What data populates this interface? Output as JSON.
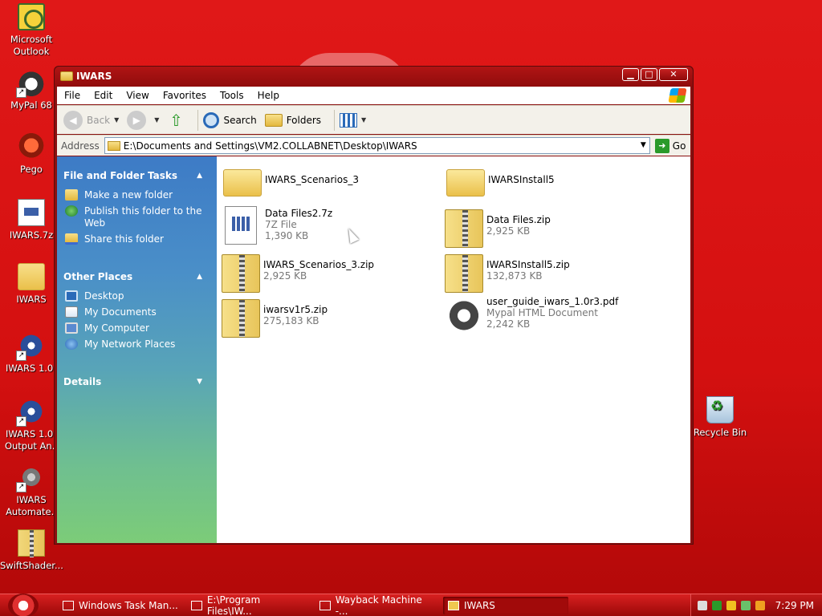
{
  "desktop": {
    "icons": [
      {
        "label": "Microsoft Outlook",
        "icon": "outlook-icon"
      },
      {
        "label": "MyPal 68",
        "icon": "mypal-icon"
      },
      {
        "label": "Pego",
        "icon": "pego-icon"
      },
      {
        "label": "IWARS.7z",
        "icon": "7z-file-icon"
      },
      {
        "label": "IWARS",
        "icon": "folder-icon"
      },
      {
        "label": "IWARS 1.0r",
        "icon": "iwars-icon"
      },
      {
        "label": "IWARS 1.0r Output An..",
        "icon": "iwars-icon"
      },
      {
        "label": "IWARS Automate..",
        "icon": "gear-icon"
      },
      {
        "label": "SwiftShader...",
        "icon": "zip-icon"
      },
      {
        "label": "Recycle Bin",
        "icon": "recycle-bin-icon"
      }
    ]
  },
  "window": {
    "title": "IWARS",
    "buttons": {
      "minimize": "▁",
      "maximize": "□",
      "close": "✕"
    }
  },
  "menu": [
    "File",
    "Edit",
    "View",
    "Favorites",
    "Tools",
    "Help"
  ],
  "toolbar": {
    "back": "Back",
    "search": "Search",
    "folders": "Folders"
  },
  "address": {
    "label": "Address",
    "value": "E:\\Documents and Settings\\VM2.COLLABNET\\Desktop\\IWARS",
    "go": "Go"
  },
  "left_pane": {
    "file_tasks": {
      "title": "File and Folder Tasks",
      "items": [
        "Make a new folder",
        "Publish this folder to the Web",
        "Share this folder"
      ]
    },
    "other_places": {
      "title": "Other Places",
      "items": [
        "Desktop",
        "My Documents",
        "My Computer",
        "My Network Places"
      ]
    },
    "details": {
      "title": "Details"
    }
  },
  "files": [
    {
      "name": "IWARS_Scenarios_3",
      "type": "",
      "size": "",
      "kind": "folder"
    },
    {
      "name": "IWARSInstall5",
      "type": "",
      "size": "",
      "kind": "folder"
    },
    {
      "name": "Data Files2.7z",
      "type": "7Z File",
      "size": "1,390 KB",
      "kind": "7z"
    },
    {
      "name": "Data Files.zip",
      "type": "",
      "size": "2,925 KB",
      "kind": "zip"
    },
    {
      "name": "IWARS_Scenarios_3.zip",
      "type": "",
      "size": "2,925 KB",
      "kind": "zip"
    },
    {
      "name": "IWARSInstall5.zip",
      "type": "",
      "size": "132,873 KB",
      "kind": "zip"
    },
    {
      "name": "iwarsv1r5.zip",
      "type": "",
      "size": "275,183 KB",
      "kind": "zip"
    },
    {
      "name": "user_guide_iwars_1.0r3.pdf",
      "type": "Mypal HTML Document",
      "size": "2,242 KB",
      "kind": "pdf"
    }
  ],
  "taskbar": {
    "tasks": [
      "Windows Task Man...",
      "E:\\Program Files\\IW...",
      "Wayback Machine -...",
      "IWARS"
    ],
    "clock": "7:29 PM"
  }
}
